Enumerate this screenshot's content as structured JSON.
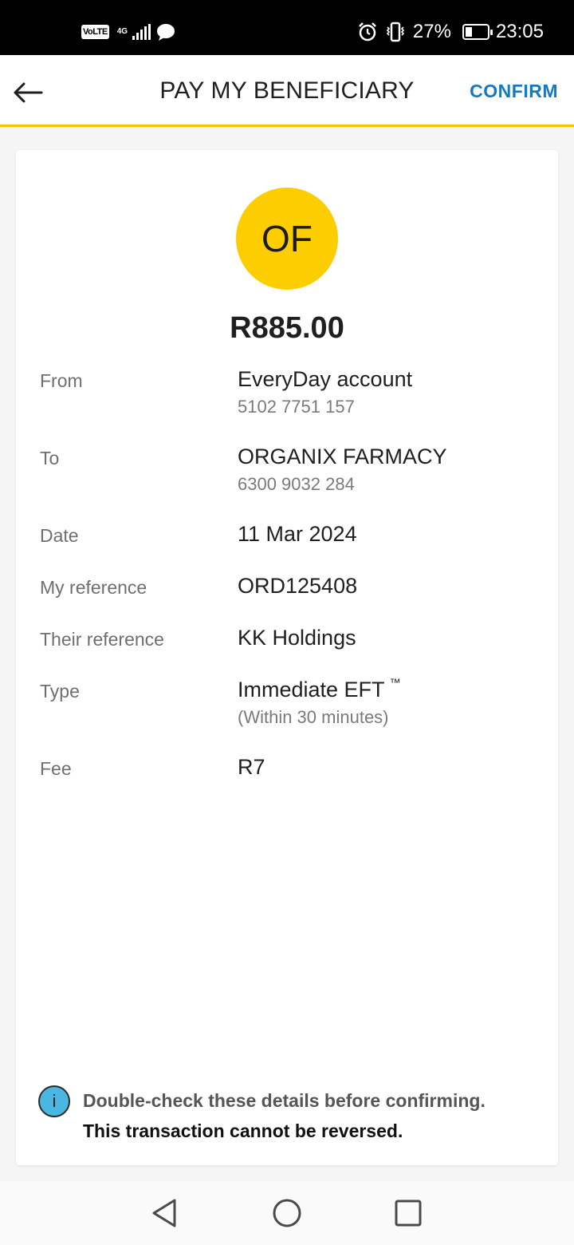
{
  "status_bar": {
    "volte": "VoLTE",
    "network": "4G",
    "battery": "27%",
    "time": "23:05"
  },
  "header": {
    "title": "PAY MY BENEFICIARY",
    "confirm_label": "CONFIRM"
  },
  "payment": {
    "avatar_initials": "OF",
    "amount": "R885.00",
    "from_label": "From",
    "from_account": "EveryDay account",
    "from_number": "5102 7751 157",
    "to_label": "To",
    "to_name": "ORGANIX FARMACY",
    "to_number": "6300 9032 284",
    "date_label": "Date",
    "date": "11 Mar 2024",
    "my_ref_label": "My reference",
    "my_ref": "ORD125408",
    "their_ref_label": "Their reference",
    "their_ref": "KK Holdings",
    "type_label": "Type",
    "type": "Immediate EFT",
    "type_tm": "™",
    "type_sub": "(Within 30 minutes)",
    "fee_label": "Fee",
    "fee": "R7"
  },
  "notice": {
    "icon": "info-icon",
    "line1": "Double-check these details before confirming.",
    "line2": "This transaction cannot be reversed."
  },
  "colors": {
    "accent_yellow": "#fccd00",
    "header_border": "#f2c500",
    "confirm_blue": "#1479c4",
    "info_blue": "#4ab7e2"
  }
}
